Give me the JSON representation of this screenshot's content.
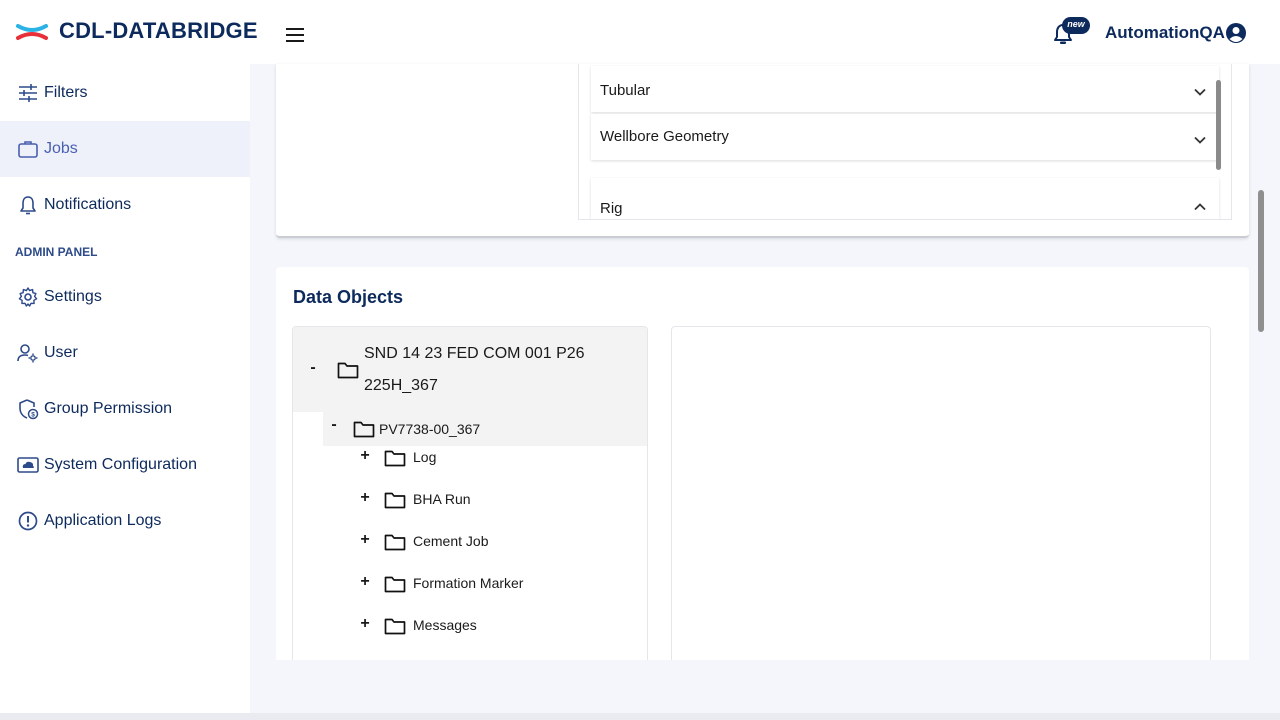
{
  "header": {
    "brand": "CDL-DATABRIDGE",
    "badge": "new",
    "username": "AutomationQA"
  },
  "sidebar": {
    "items": [
      {
        "label": "Filters",
        "icon": "sliders-icon"
      },
      {
        "label": "Jobs",
        "icon": "briefcase-icon",
        "active": true
      },
      {
        "label": "Notifications",
        "icon": "bell-icon"
      }
    ],
    "section_label": "ADMIN PANEL",
    "admin_items": [
      {
        "label": "Settings",
        "icon": "gear-icon"
      },
      {
        "label": "User",
        "icon": "user-settings-icon"
      },
      {
        "label": "Group Permission",
        "icon": "shield-icon"
      },
      {
        "label": "System Configuration",
        "icon": "cloud-monitor-icon"
      },
      {
        "label": "Application Logs",
        "icon": "alert-circle-icon"
      }
    ]
  },
  "accordion": {
    "items": [
      {
        "label": "Tubular",
        "state": "collapsed"
      },
      {
        "label": "Wellbore Geometry",
        "state": "collapsed"
      },
      {
        "label": "Rig",
        "state": "expanded"
      }
    ]
  },
  "data_objects": {
    "title": "Data Objects",
    "root": {
      "toggle": "-",
      "label_line1": "SND 14 23 FED COM 001 P26",
      "label_line2": "225H_367"
    },
    "child": {
      "toggle": "-",
      "label": "PV7738-00_367"
    },
    "leaves": [
      {
        "toggle": "+",
        "label": "Log"
      },
      {
        "toggle": "+",
        "label": "BHA Run"
      },
      {
        "toggle": "+",
        "label": "Cement Job"
      },
      {
        "toggle": "+",
        "label": "Formation Marker"
      },
      {
        "toggle": "+",
        "label": "Messages"
      }
    ]
  },
  "colors": {
    "brand_navy": "#0d2a5c",
    "active_bg": "#eef1fa",
    "active_text": "#4a5fb0",
    "logo_red": "#e8303a",
    "logo_blue": "#2bb3e6"
  }
}
